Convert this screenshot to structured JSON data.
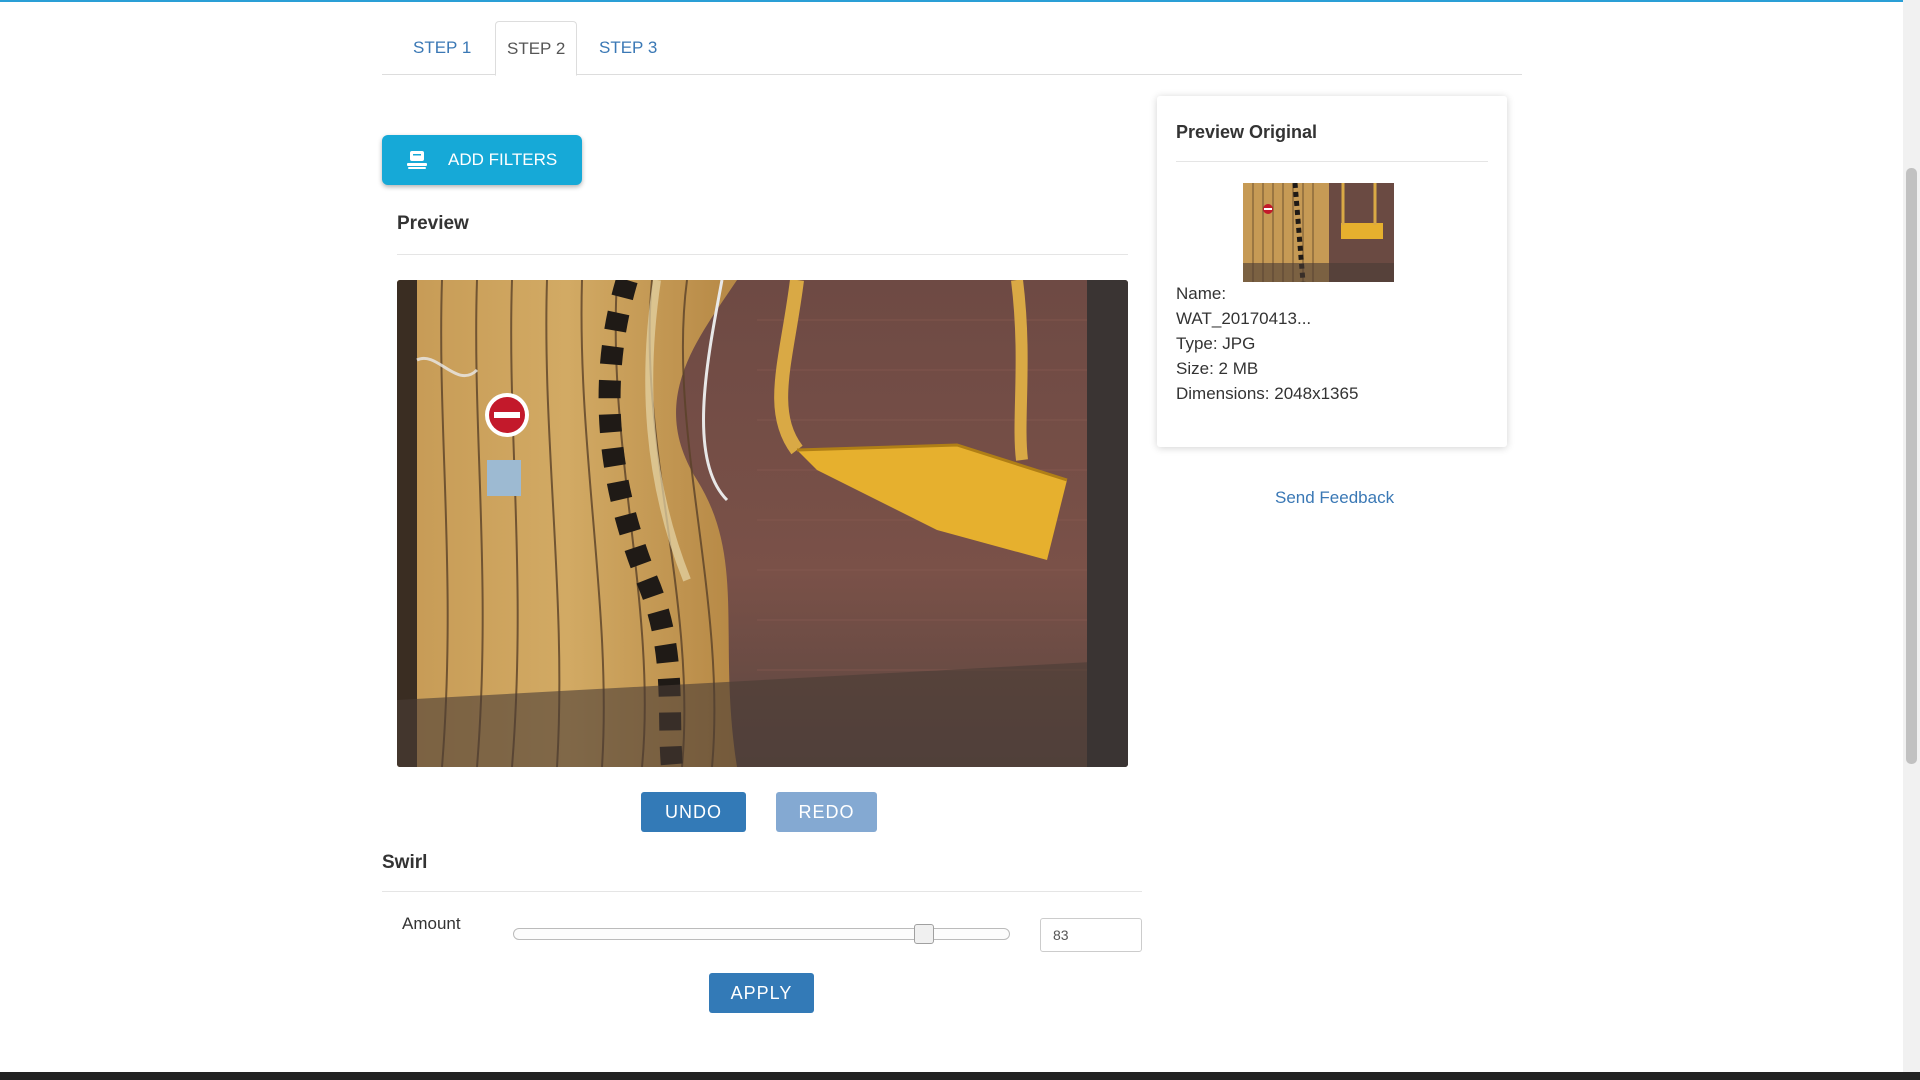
{
  "tabs": [
    {
      "label": "STEP 1"
    },
    {
      "label": "STEP 2"
    },
    {
      "label": "STEP 3"
    }
  ],
  "active_tab": "STEP 2",
  "toolbar": {
    "add_filters_label": "ADD FILTERS",
    "add_filters_icon": "filter-stack-icon"
  },
  "preview": {
    "title": "Preview"
  },
  "history": {
    "undo_label": "UNDO",
    "redo_label": "REDO"
  },
  "filter": {
    "title": "Swirl",
    "amount_label": "Amount",
    "amount_value": "83",
    "slider_min": 0,
    "slider_max": 100,
    "slider_value": 83,
    "apply_label": "APPLY"
  },
  "original": {
    "title": "Preview Original",
    "name_label": "Name:",
    "name_value": "WAT_20170413...",
    "type_text": "Type: JPG",
    "size_text": "Size: 2 MB",
    "dimensions_text": "Dimensions: 2048x1365"
  },
  "feedback_label": "Send Feedback",
  "colors": {
    "accent": "#16a9d7",
    "primary": "#337ab7",
    "link": "#3a78b5"
  }
}
